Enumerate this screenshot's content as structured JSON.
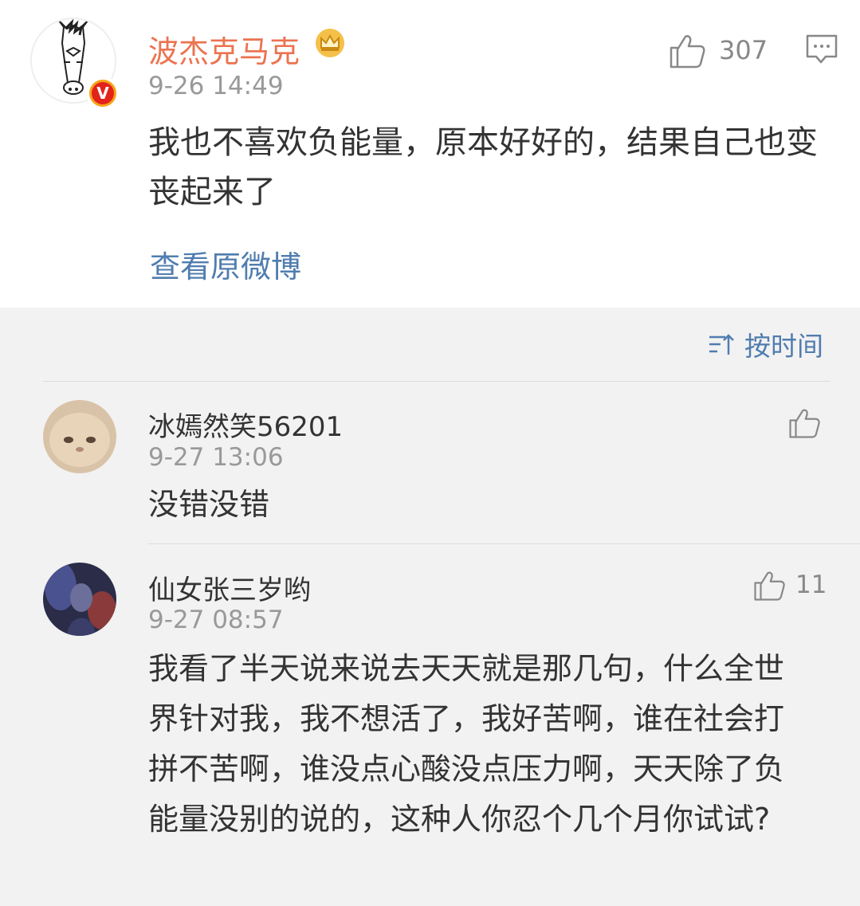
{
  "post": {
    "author": "波杰克马克",
    "time": "9-26 14:49",
    "like_count": "307",
    "content": "我也不喜欢负能量，原本好好的，结果自己也变丧起来了",
    "view_original": "查看原微博",
    "badge": "V"
  },
  "sort": {
    "label": "按时间"
  },
  "comments": [
    {
      "name": "冰嫣然笑56201",
      "time": "9-27 13:06",
      "text": "没错没错",
      "likes": ""
    },
    {
      "name": "仙女张三岁哟",
      "time": "9-27 08:57",
      "text": "我看了半天说来说去天天就是那几句，什么全世界针对我，我不想活了，我好苦啊，谁在社会打拼不苦啊，谁没点心酸没点压力啊，天天除了负能量没别的说的，这种人你忍个几个月你试试?",
      "likes": "11"
    }
  ],
  "colors": {
    "name_orange": "#eb7350",
    "link_blue": "#507daf",
    "meta_gray": "#999999",
    "page_bg": "#f2f2f2"
  },
  "icons": {
    "like": "thumbs-up-icon",
    "reply": "comment-icon",
    "sort": "sort-icon",
    "crown": "crown-icon"
  }
}
